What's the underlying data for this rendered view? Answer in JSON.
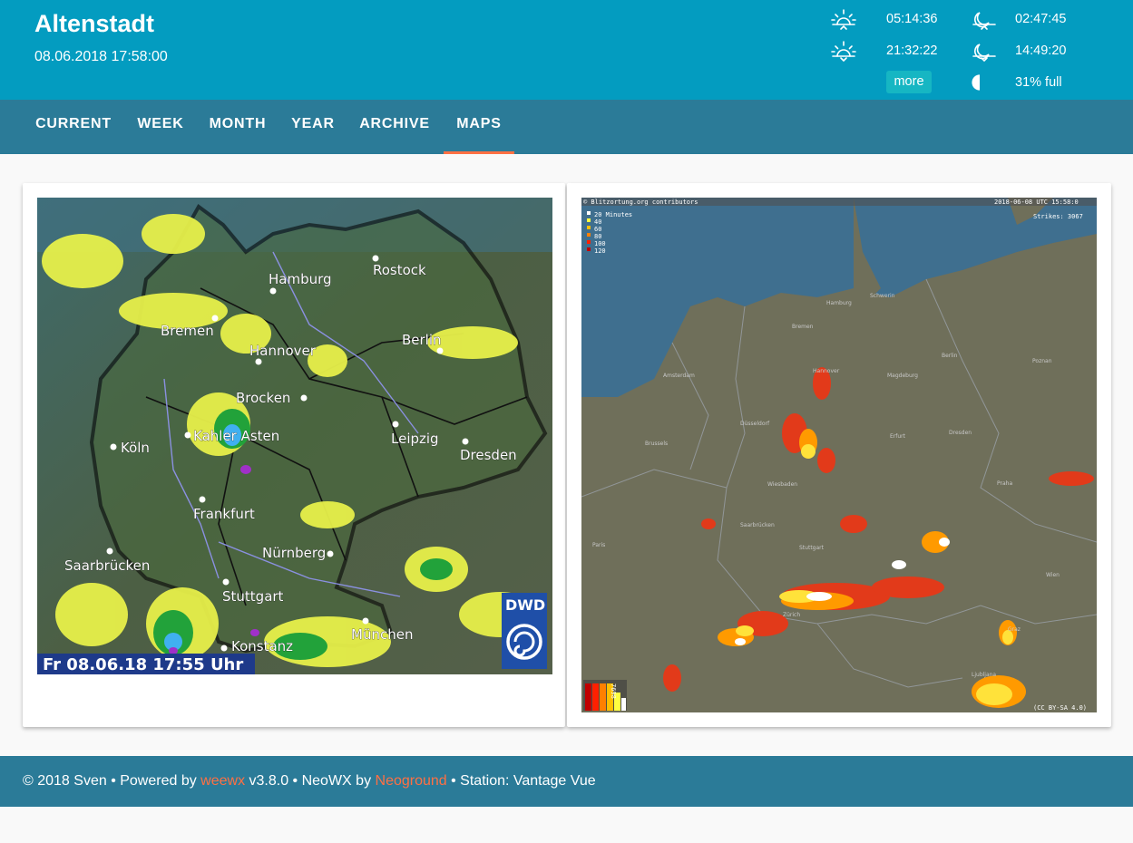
{
  "header": {
    "title": "Altenstadt",
    "datetime": "08.06.2018 17:58:00",
    "sunrise": "05:14:36",
    "sunset": "21:32:22",
    "moonrise": "02:47:45",
    "moonset": "14:49:20",
    "more_label": "more",
    "moon_phase": "31% full",
    "icons": [
      "sunrise-icon",
      "sunset-icon",
      "moonrise-icon",
      "moonset-icon",
      "moon-phase-icon"
    ]
  },
  "nav": {
    "tabs": [
      {
        "label": "CURRENT",
        "active": false
      },
      {
        "label": "WEEK",
        "active": false
      },
      {
        "label": "MONTH",
        "active": false
      },
      {
        "label": "YEAR",
        "active": false
      },
      {
        "label": "ARCHIVE",
        "active": false
      },
      {
        "label": "MAPS",
        "active": true
      }
    ],
    "accent_color": "#ff7043"
  },
  "radar_map": {
    "cities": [
      "Hamburg",
      "Rostock",
      "Bremen",
      "Hannover",
      "Berlin",
      "Brocken",
      "Köln",
      "Kahler Asten",
      "Leipzig",
      "Dresden",
      "Frankfurt",
      "Nürnberg",
      "Saarbrücken",
      "Stuttgart",
      "Konstanz",
      "München"
    ],
    "timestamp": "Fr 08.06.18   17:55 Uhr",
    "logo_text": "DWD"
  },
  "lightning_map": {
    "attribution": "© Blitzortung.org contributors",
    "timestamp": "2018-06-08 UTC 15:58:0",
    "strikes": "Strikes: 3067",
    "legend": [
      "20 Minutes",
      "40",
      "60",
      "80",
      "100",
      "120"
    ],
    "counter": "7698",
    "license": "(CC BY-SA 4.0)",
    "cities": [
      "Hamburg",
      "Schwerin",
      "Bremen",
      "Berlin",
      "Amsterdam",
      "Hannover",
      "Magdeburg",
      "Poznan",
      "Düsseldorf",
      "Brussels",
      "Erfurt",
      "Dresden",
      "Wiesbaden",
      "Praha",
      "Saarbrücken",
      "Paris",
      "Stuttgart",
      "Zürich",
      "Wien",
      "Graz",
      "Ljubljana"
    ]
  },
  "footer": {
    "copyright": "© 2018 Sven • Powered by ",
    "weewx_link": "weewx",
    "version": " v3.8.0 • NeoWX by ",
    "neoground_link": "Neoground",
    "station": " • Station: Vantage Vue"
  }
}
